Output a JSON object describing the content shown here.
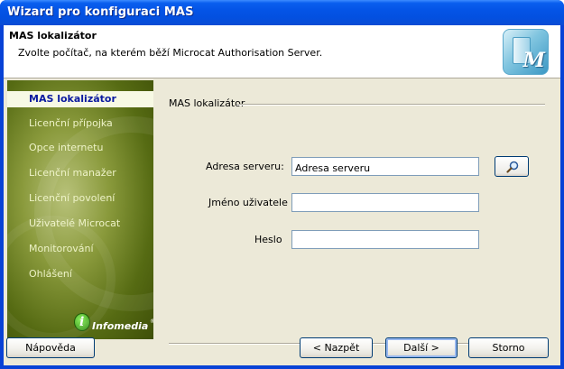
{
  "window": {
    "title": "Wizard pro konfiguraci MAS"
  },
  "header": {
    "title": "MAS lokalizátor",
    "subtitle": "Zvolte počítač, na kterém běží Microcat Authorisation Server.",
    "icon": "mas-server-icon"
  },
  "sidebar": {
    "items": [
      {
        "label": "MAS lokalizátor",
        "active": true
      },
      {
        "label": "Licenční přípojka",
        "active": false
      },
      {
        "label": "Opce internetu",
        "active": false
      },
      {
        "label": "Licenční manažer",
        "active": false
      },
      {
        "label": "Licenční povolení",
        "active": false
      },
      {
        "label": "Uživatelé Microcat",
        "active": false
      },
      {
        "label": "Monitorování",
        "active": false
      },
      {
        "label": "Ohlášení",
        "active": false
      }
    ],
    "logo": {
      "text": "Infomedia",
      "mark": "i"
    }
  },
  "content": {
    "group_label": "MAS lokalizátor",
    "fields": {
      "server": {
        "label": "Adresa serveru:",
        "value": "Adresa serveru"
      },
      "user": {
        "label": "Jméno uživatele",
        "value": ""
      },
      "password": {
        "label": "Heslo",
        "value": ""
      }
    }
  },
  "buttons": {
    "help": "Nápověda",
    "back": "< Nazpět",
    "next": "Další >",
    "cancel": "Storno"
  },
  "colors": {
    "titlebar": "#0454e6",
    "client": "#ece9d8",
    "sidebar": "#6b7d22",
    "active_nav": "#0a1aa0"
  }
}
